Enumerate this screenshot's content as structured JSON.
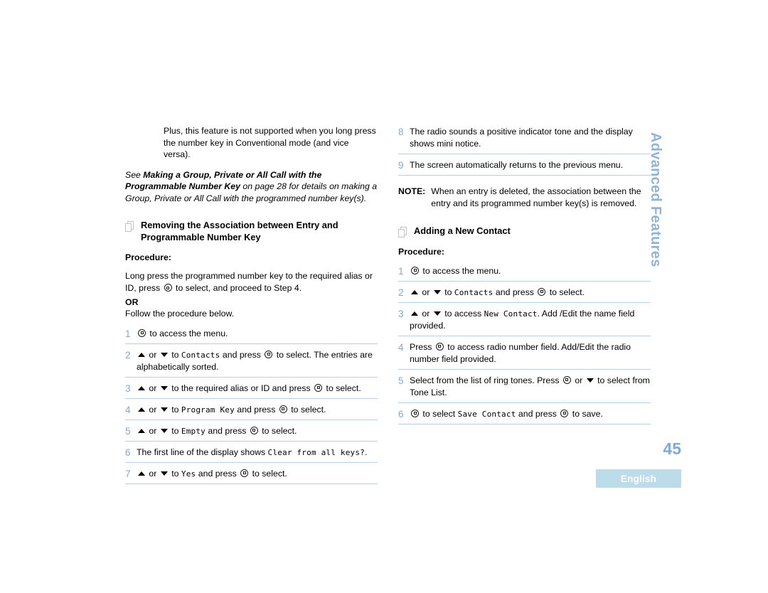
{
  "page": {
    "number": "45",
    "language_tab": "English",
    "side_tab": "Advanced Features"
  },
  "left_column": {
    "intro_paragraph": "Plus, this feature is not supported when you long press the number key in Conventional mode (and vice versa).",
    "cross_reference": {
      "lead": "See ",
      "bold_title": "Making a Group, Private or All Call with the Programmable Number Key",
      "tail": " on page 28 for details on making a Group, Private or All Call with the programmed number key(s)."
    },
    "section": {
      "icon": "stacked-pages-icon",
      "title": "Removing the Association between Entry and Programmable Number Key",
      "procedure_label": "Procedure:",
      "preamble_part1": "Long press the programmed number key to the required alias or ID, press ",
      "preamble_part2": " to select, and proceed to Step 4.",
      "or_label": "OR",
      "follow_line": "Follow the procedure below.",
      "steps": [
        {
          "number": "1",
          "parts": [
            {
              "type": "button"
            },
            {
              "type": "text",
              "text": " to access the menu."
            }
          ]
        },
        {
          "number": "2",
          "parts": [
            {
              "type": "up"
            },
            {
              "type": "text",
              "text": " or "
            },
            {
              "type": "down"
            },
            {
              "type": "text",
              "text": " to "
            },
            {
              "type": "code",
              "text": "Contacts"
            },
            {
              "type": "text",
              "text": " and press "
            },
            {
              "type": "button"
            },
            {
              "type": "text",
              "text": " to select. The entries are alphabetically sorted."
            }
          ]
        },
        {
          "number": "3",
          "parts": [
            {
              "type": "up"
            },
            {
              "type": "text",
              "text": " or "
            },
            {
              "type": "down"
            },
            {
              "type": "text",
              "text": " to the required alias or ID and press "
            },
            {
              "type": "button"
            },
            {
              "type": "text",
              "text": " to select."
            }
          ]
        },
        {
          "number": "4",
          "parts": [
            {
              "type": "up"
            },
            {
              "type": "text",
              "text": " or "
            },
            {
              "type": "down"
            },
            {
              "type": "text",
              "text": " to "
            },
            {
              "type": "code",
              "text": "Program Key"
            },
            {
              "type": "text",
              "text": " and press "
            },
            {
              "type": "button"
            },
            {
              "type": "text",
              "text": " to select."
            }
          ]
        },
        {
          "number": "5",
          "parts": [
            {
              "type": "up"
            },
            {
              "type": "text",
              "text": " or "
            },
            {
              "type": "down"
            },
            {
              "type": "text",
              "text": " to "
            },
            {
              "type": "code",
              "text": "Empty"
            },
            {
              "type": "text",
              "text": " and press "
            },
            {
              "type": "button"
            },
            {
              "type": "text",
              "text": " to select."
            }
          ]
        },
        {
          "number": "6",
          "parts": [
            {
              "type": "text",
              "text": "The first line of the display shows "
            },
            {
              "type": "code",
              "text": "Clear from all keys?"
            },
            {
              "type": "text",
              "text": "."
            }
          ]
        },
        {
          "number": "7",
          "parts": [
            {
              "type": "up"
            },
            {
              "type": "text",
              "text": " or "
            },
            {
              "type": "down"
            },
            {
              "type": "text",
              "text": " to "
            },
            {
              "type": "code",
              "text": "Yes"
            },
            {
              "type": "text",
              "text": " and press "
            },
            {
              "type": "button"
            },
            {
              "type": "text",
              "text": " to select."
            }
          ]
        }
      ]
    }
  },
  "right_column": {
    "continued_steps": [
      {
        "number": "8",
        "parts": [
          {
            "type": "text",
            "text": "The radio sounds a positive indicator tone and the display shows mini notice."
          }
        ]
      },
      {
        "number": "9",
        "parts": [
          {
            "type": "text",
            "text": "The screen automatically returns to the previous menu."
          }
        ]
      }
    ],
    "note": {
      "label": "NOTE:",
      "text": "When an entry is deleted, the association between the entry and its programmed number key(s) is removed."
    },
    "section": {
      "icon": "stacked-pages-icon",
      "title": "Adding a New Contact",
      "procedure_label": "Procedure:",
      "steps": [
        {
          "number": "1",
          "parts": [
            {
              "type": "button"
            },
            {
              "type": "text",
              "text": " to access the  menu."
            }
          ]
        },
        {
          "number": "2",
          "parts": [
            {
              "type": "up"
            },
            {
              "type": "text",
              "text": " or "
            },
            {
              "type": "down"
            },
            {
              "type": "text",
              "text": " to "
            },
            {
              "type": "code",
              "text": "Contacts"
            },
            {
              "type": "text",
              "text": " and press "
            },
            {
              "type": "button"
            },
            {
              "type": "text",
              "text": " to select."
            }
          ]
        },
        {
          "number": "3",
          "parts": [
            {
              "type": "up"
            },
            {
              "type": "text",
              "text": " or "
            },
            {
              "type": "down"
            },
            {
              "type": "text",
              "text": " to access "
            },
            {
              "type": "code",
              "text": "New Contact"
            },
            {
              "type": "text",
              "text": ". Add /Edit the name field provided."
            }
          ]
        },
        {
          "number": "4",
          "parts": [
            {
              "type": "text",
              "text": "Press "
            },
            {
              "type": "button"
            },
            {
              "type": "text",
              "text": " to access radio number field. Add/Edit the radio number field provided."
            }
          ]
        },
        {
          "number": "5",
          "parts": [
            {
              "type": "text",
              "text": "Select from the list of ring tones. Press "
            },
            {
              "type": "button"
            },
            {
              "type": "text",
              "text": " or "
            },
            {
              "type": "down"
            },
            {
              "type": "text",
              "text": " to select from Tone List."
            }
          ]
        },
        {
          "number": "6",
          "parts": [
            {
              "type": "button"
            },
            {
              "type": "text",
              "text": " to select "
            },
            {
              "type": "code",
              "text": "Save Contact"
            },
            {
              "type": "text",
              "text": " and press "
            },
            {
              "type": "button"
            },
            {
              "type": "text",
              "text": " to save."
            }
          ]
        }
      ]
    }
  }
}
